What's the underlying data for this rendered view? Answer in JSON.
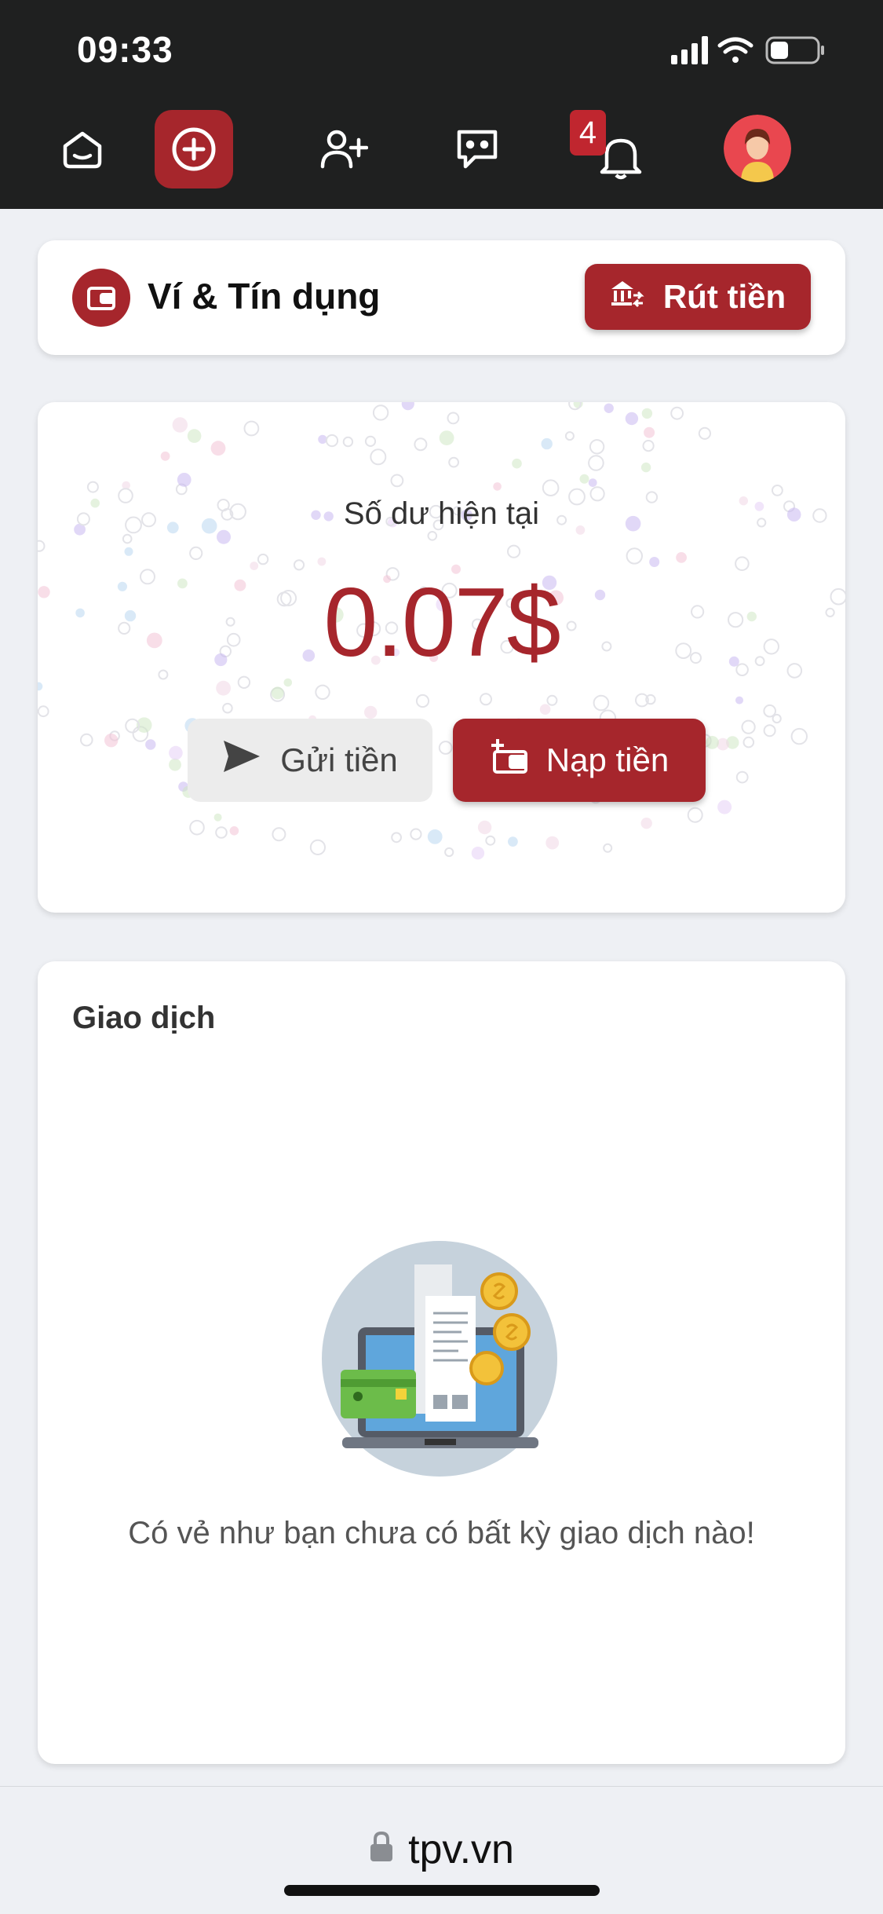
{
  "status_bar": {
    "time": "09:33"
  },
  "nav": {
    "items": [
      {
        "name": "home-icon"
      },
      {
        "name": "add-circle-icon"
      },
      {
        "name": "add-user-icon"
      },
      {
        "name": "chat-icon"
      },
      {
        "name": "bell-icon"
      },
      {
        "name": "avatar"
      }
    ],
    "notification_count": "4"
  },
  "wallet": {
    "title": "Ví & Tín dụng",
    "withdraw_label": "Rút tiền"
  },
  "balance": {
    "label": "Số dư hiện tại",
    "value": "0.07$",
    "send_label": "Gửi tiền",
    "deposit_label": "Nạp tiền"
  },
  "transactions": {
    "title": "Giao dịch",
    "empty_message": "Có vẻ như bạn chưa có bất kỳ giao dịch nào!"
  },
  "browser": {
    "url": "tpv.vn"
  },
  "colors": {
    "brand": "#a6262c",
    "topbar": "#1f2020",
    "background": "#eef0f4"
  }
}
